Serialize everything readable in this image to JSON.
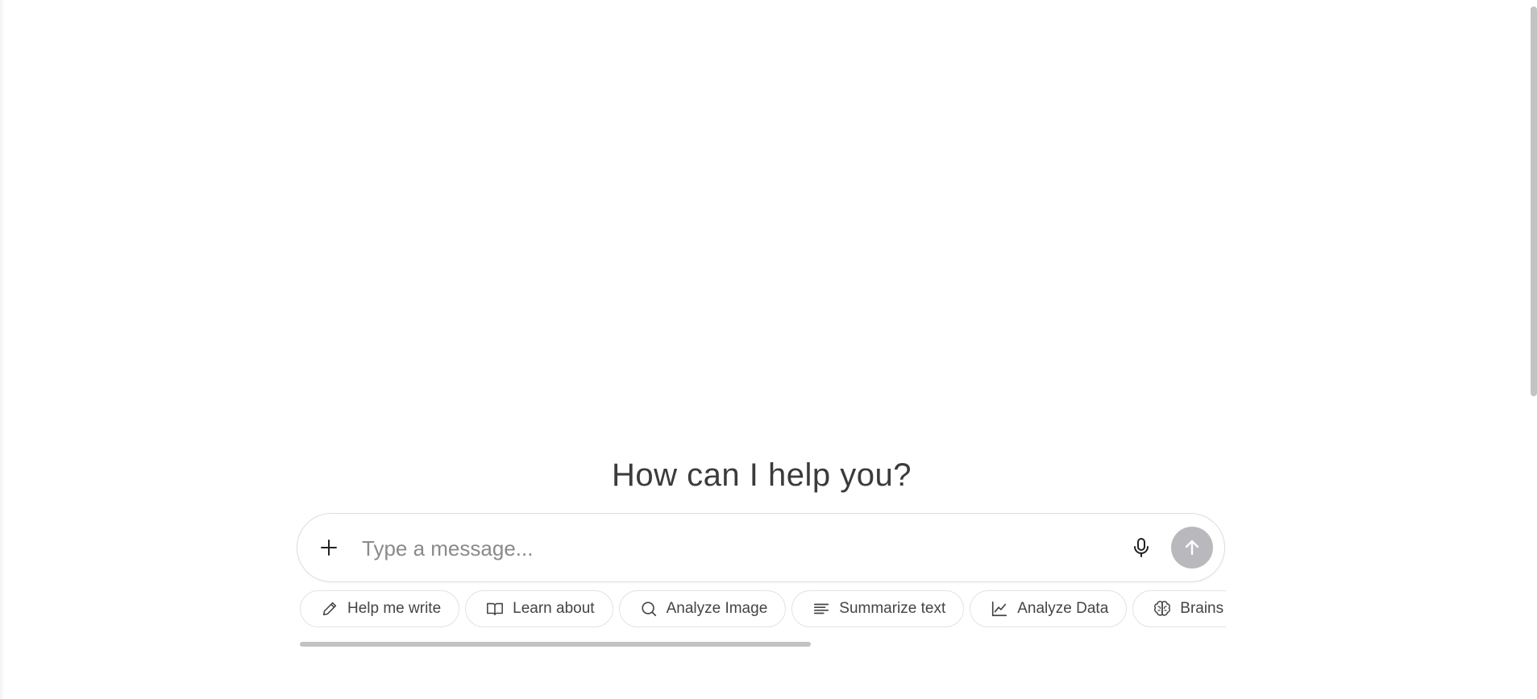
{
  "heading": "How can I help you?",
  "composer": {
    "placeholder": "Type a message...",
    "value": "",
    "icons": {
      "attach": "plus-icon",
      "voice": "microphone-icon",
      "send": "arrow-up-icon"
    },
    "send_button_color": "#b9b9bd"
  },
  "suggestions": [
    {
      "label": "Help me write",
      "icon": "pencil-icon"
    },
    {
      "label": "Learn about",
      "icon": "book-icon"
    },
    {
      "label": "Analyze Image",
      "icon": "magnifier-icon"
    },
    {
      "label": "Summarize text",
      "icon": "text-lines-icon"
    },
    {
      "label": "Analyze Data",
      "icon": "line-chart-icon"
    },
    {
      "label": "Brains",
      "icon": "brain-icon"
    }
  ]
}
